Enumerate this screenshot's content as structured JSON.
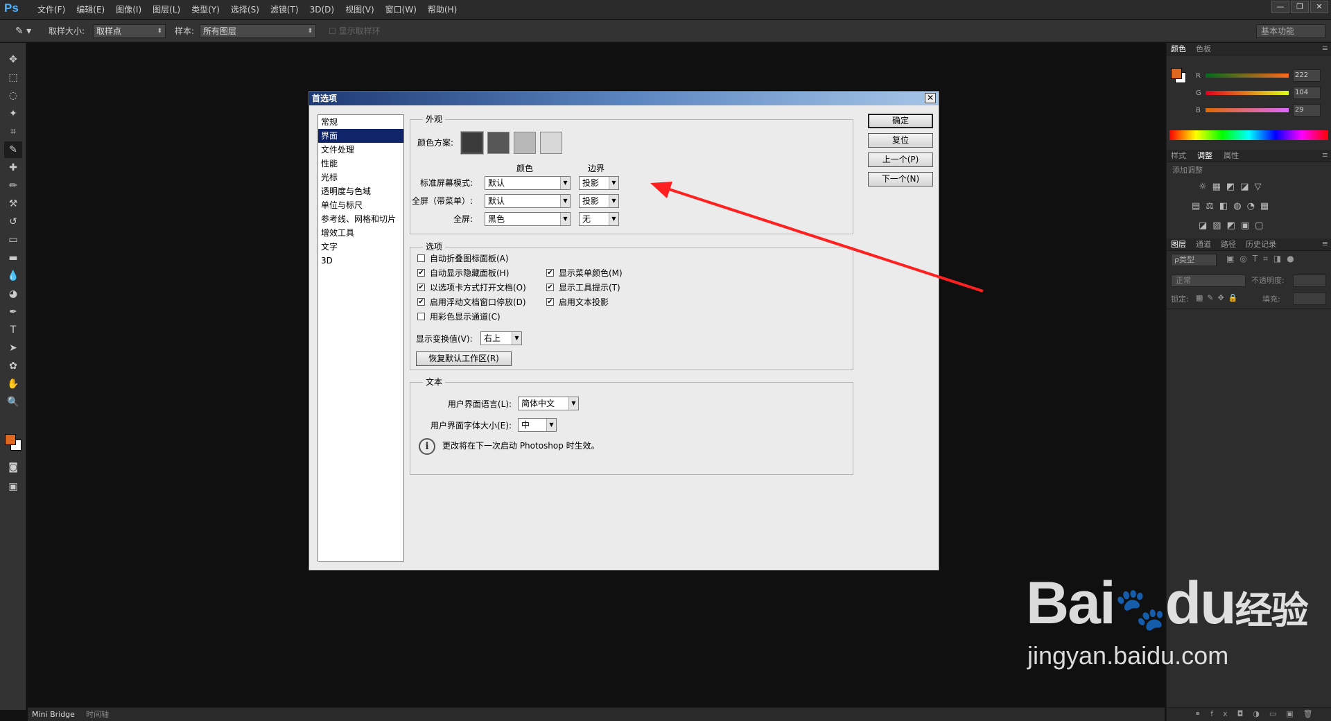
{
  "app": {
    "logo": "Ps"
  },
  "menu": [
    "文件(F)",
    "编辑(E)",
    "图像(I)",
    "图层(L)",
    "类型(Y)",
    "选择(S)",
    "滤镜(T)",
    "3D(D)",
    "视图(V)",
    "窗口(W)",
    "帮助(H)"
  ],
  "window_buttons": {
    "minimize": "—",
    "restore": "❐",
    "close": "✕"
  },
  "options": {
    "sample_size_label": "取样大小:",
    "sample_size_value": "取样点",
    "sample_label": "样本:",
    "sample_value": "所有图层",
    "show_ring_label": "显示取样环",
    "workspace": "基本功能"
  },
  "tools": [
    "move-tool",
    "marquee-tool",
    "lasso-tool",
    "magic-wand-tool",
    "crop-tool",
    "eyedropper-tool",
    "healing-brush-tool",
    "brush-tool",
    "clone-stamp-tool",
    "history-brush-tool",
    "eraser-tool",
    "gradient-tool",
    "blur-tool",
    "dodge-tool",
    "pen-tool",
    "type-tool",
    "path-selection-tool",
    "shape-tool",
    "hand-tool",
    "zoom-tool"
  ],
  "colors": {
    "foreground": "#de6820",
    "background": "#ffffff"
  },
  "color_panel": {
    "tabs": [
      "颜色",
      "色板"
    ],
    "r": {
      "label": "R",
      "value": "222"
    },
    "g": {
      "label": "G",
      "value": "104"
    },
    "b": {
      "label": "B",
      "value": "29"
    }
  },
  "adjust_panel": {
    "tabs": [
      "样式",
      "调整",
      "属性"
    ],
    "title": "添加调整"
  },
  "layers_panel": {
    "tabs": [
      "图层",
      "通道",
      "路径",
      "历史记录"
    ],
    "kind": "ρ类型",
    "blend": "正常",
    "opacity_label": "不透明度:",
    "lock_label": "锁定:",
    "fill_label": "填充:"
  },
  "bottom_tabs": [
    "Mini Bridge",
    "时间轴"
  ],
  "dialog": {
    "title": "首选项",
    "close": "✕",
    "categories": [
      "常规",
      "界面",
      "文件处理",
      "性能",
      "光标",
      "透明度与色域",
      "单位与标尺",
      "参考线、网格和切片",
      "增效工具",
      "文字",
      "3D"
    ],
    "selected_category": "界面",
    "appearance": {
      "title": "外观",
      "color_scheme_label": "颜色方案:",
      "scheme_colors": [
        "#3b3b3b",
        "#575757",
        "#b8b8b8",
        "#d8d8d8"
      ],
      "col_color": "颜色",
      "col_border": "边界",
      "rows": [
        {
          "label": "标准屏幕模式:",
          "color": "默认",
          "border": "投影"
        },
        {
          "label": "全屏（带菜单）:",
          "color": "默认",
          "border": "投影"
        },
        {
          "label": "全屏:",
          "color": "黑色",
          "border": "无"
        }
      ]
    },
    "options": {
      "title": "选项",
      "left": [
        {
          "label": "自动折叠图标面板(A)",
          "checked": false
        },
        {
          "label": "自动显示隐藏面板(H)",
          "checked": true
        },
        {
          "label": "以选项卡方式打开文档(O)",
          "checked": true
        },
        {
          "label": "启用浮动文档窗口停放(D)",
          "checked": true
        },
        {
          "label": "用彩色显示通道(C)",
          "checked": false
        }
      ],
      "right": [
        {
          "label": "显示菜单颜色(M)",
          "checked": true
        },
        {
          "label": "显示工具提示(T)",
          "checked": true
        },
        {
          "label": "启用文本投影",
          "checked": true
        }
      ],
      "transform_label": "显示变换值(V):",
      "transform_value": "右上",
      "restore_button": "恢复默认工作区(R)"
    },
    "text": {
      "title": "文本",
      "language_label": "用户界面语言(L):",
      "language_value": "简体中文",
      "fontsize_label": "用户界面字体大小(E):",
      "fontsize_value": "中",
      "note": "更改将在下一次启动 Photoshop 时生效。"
    },
    "buttons": {
      "ok": "确定",
      "reset": "复位",
      "prev": "上一个(P)",
      "next": "下一个(N)"
    }
  },
  "watermark": {
    "brand": "Bai",
    "brand2": "du",
    "suffix": "经验",
    "url": "jingyan.baidu.com"
  }
}
